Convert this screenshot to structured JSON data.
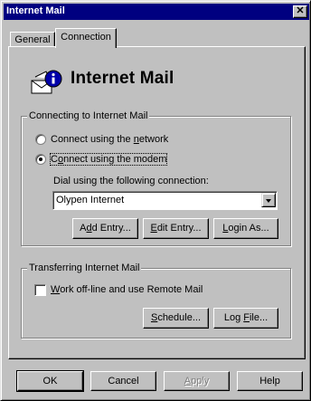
{
  "window": {
    "title": "Internet Mail",
    "close_glyph": "✕"
  },
  "tabs": [
    {
      "label": "General",
      "active": false
    },
    {
      "label": "Connection",
      "active": true
    }
  ],
  "header": {
    "title": "Internet Mail",
    "icon": "mail-envelope-info-icon"
  },
  "connecting_group": {
    "legend": "Connecting to Internet Mail",
    "options": [
      {
        "prefix": "Connect using the ",
        "mnemonic": "n",
        "suffix": "etwork",
        "selected": false
      },
      {
        "prefix": "C",
        "mnemonic": "o",
        "suffix": "nnect using the modem",
        "selected": true
      }
    ],
    "dial_label": "Dial using the following connection:",
    "dial_value": "Olypen Internet",
    "buttons": [
      {
        "pre": "A",
        "mnemonic": "d",
        "post": "d Entry..."
      },
      {
        "pre": "",
        "mnemonic": "E",
        "post": "dit Entry..."
      },
      {
        "pre": "",
        "mnemonic": "L",
        "post": "ogin As..."
      }
    ]
  },
  "transferring_group": {
    "legend": "Transferring Internet Mail",
    "offline_prefix": "",
    "offline_mnemonic": "W",
    "offline_suffix": "ork off-line and use Remote Mail",
    "offline_checked": false,
    "buttons": [
      {
        "pre": "",
        "mnemonic": "S",
        "post": "chedule..."
      },
      {
        "pre": "Log ",
        "mnemonic": "F",
        "post": "ile..."
      }
    ]
  },
  "footer": {
    "ok": "OK",
    "cancel": "Cancel",
    "apply_pre": "",
    "apply_mnemonic": "A",
    "apply_post": "pply",
    "help": "Help"
  },
  "colors": {
    "titlebar": "#000080",
    "face": "#c0c0c0",
    "disabled_text": "#808080"
  }
}
